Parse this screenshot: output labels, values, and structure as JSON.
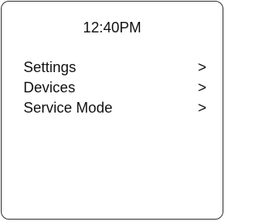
{
  "screen": {
    "time": "12:40PM",
    "menu": [
      {
        "label": "Settings",
        "arrow": ">"
      },
      {
        "label": "Devices",
        "arrow": ">"
      },
      {
        "label": "Service Mode",
        "arrow": ">"
      }
    ]
  }
}
